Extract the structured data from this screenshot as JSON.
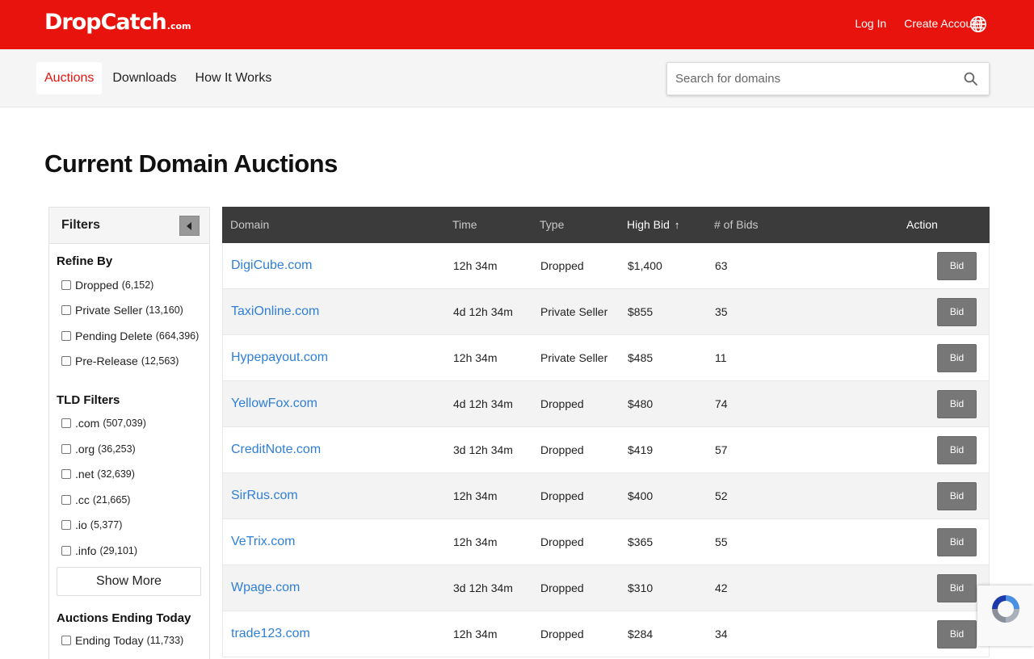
{
  "brand": {
    "name": "DropCatch",
    "tld": ".com"
  },
  "header": {
    "login_label": "Log In",
    "create_account_label": "Create Account",
    "language_icon": "globe-icon"
  },
  "nav": {
    "tabs": [
      {
        "label": "Auctions",
        "active": true
      },
      {
        "label": "Downloads",
        "active": false
      },
      {
        "label": "How It Works",
        "active": false
      }
    ],
    "search": {
      "placeholder": "Search for domains",
      "value": "",
      "icon": "search-icon"
    }
  },
  "page": {
    "title": "Current Domain Auctions"
  },
  "filters": {
    "title": "Filters",
    "refine": {
      "title": "Refine By",
      "options": [
        {
          "label": "Dropped",
          "count": "(6,152)"
        },
        {
          "label": "Private Seller",
          "count": "(13,160)"
        },
        {
          "label": "Pending Delete",
          "count": "(664,396)"
        },
        {
          "label": "Pre-Release",
          "count": "(12,563)"
        }
      ]
    },
    "tld": {
      "title": "TLD Filters",
      "options": [
        {
          "label": ".com",
          "count": "(507,039)"
        },
        {
          "label": ".org",
          "count": "(36,253)"
        },
        {
          "label": ".net",
          "count": "(32,639)"
        },
        {
          "label": ".cc",
          "count": "(21,665)"
        },
        {
          "label": ".io",
          "count": "(5,377)"
        },
        {
          "label": ".info",
          "count": "(29,101)"
        }
      ],
      "show_more_label": "Show More"
    },
    "ending": {
      "title": "Auctions Ending Today",
      "options": [
        {
          "label": "Ending Today",
          "count": "(11,733)"
        }
      ]
    }
  },
  "table": {
    "columns": {
      "domain": "Domain",
      "time": "Time",
      "type": "Type",
      "high_bid": "High Bid",
      "num_bids": "# of Bids",
      "action": "Action"
    },
    "sort": {
      "column": "high_bid",
      "icon": "arrow-up-icon"
    },
    "rows": [
      {
        "domain": "DigiCube.com",
        "time": "12h 34m",
        "type": "Dropped",
        "high_bid": "$1,400",
        "bids": "63",
        "action": "Bid"
      },
      {
        "domain": "TaxiOnline.com",
        "time": "4d 12h 34m",
        "type": "Private Seller",
        "high_bid": "$855",
        "bids": "35",
        "action": "Bid"
      },
      {
        "domain": "Hypepayout.com",
        "time": "12h 34m",
        "type": "Private Seller",
        "high_bid": "$485",
        "bids": "11",
        "action": "Bid"
      },
      {
        "domain": "YellowFox.com",
        "time": "4d 12h 34m",
        "type": "Dropped",
        "high_bid": "$480",
        "bids": "74",
        "action": "Bid"
      },
      {
        "domain": "CreditNote.com",
        "time": "3d 12h 34m",
        "type": "Dropped",
        "high_bid": "$419",
        "bids": "57",
        "action": "Bid"
      },
      {
        "domain": "SirRus.com",
        "time": "12h 34m",
        "type": "Dropped",
        "high_bid": "$400",
        "bids": "52",
        "action": "Bid"
      },
      {
        "domain": "VeTrix.com",
        "time": "12h 34m",
        "type": "Dropped",
        "high_bid": "$365",
        "bids": "55",
        "action": "Bid"
      },
      {
        "domain": "Wpage.com",
        "time": "3d 12h 34m",
        "type": "Dropped",
        "high_bid": "$310",
        "bids": "42",
        "action": "Bid"
      },
      {
        "domain": "trade123.com",
        "time": "12h 34m",
        "type": "Dropped",
        "high_bid": "$284",
        "bids": "34",
        "action": "Bid"
      }
    ]
  },
  "colors": {
    "brand_red": "#e8130c",
    "link_blue": "#2f7fd6",
    "header_dark": "#3b3b3b"
  },
  "badge": {
    "icon": "recaptcha-icon"
  }
}
